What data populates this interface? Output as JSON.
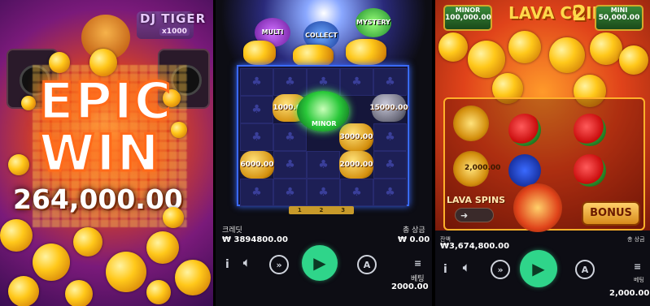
{
  "panel1": {
    "logo_title": "DJ TIGER",
    "logo_multiplier": "x1000",
    "headline_line1": "EPIC",
    "headline_line2": "WIN",
    "win_amount": "264,000.00"
  },
  "panel2": {
    "bonus_labels": [
      "MULTI",
      "COLLECT",
      "MYSTERY"
    ],
    "grid_values": [
      "1000.00",
      "15000.00",
      "3000.00",
      "6000.00",
      "2000.00"
    ],
    "center_symbol_label": "MINOR",
    "pages": [
      "1",
      "2",
      "3"
    ],
    "credit_label": "크레딧",
    "credit_value": "₩ 3894800.00",
    "total_win_label": "총 상금",
    "total_win_value": "₩ 0.00",
    "bet_label": "베팅",
    "bet_value": "2000.00",
    "info_label": "i",
    "accent_color": "#2fd58a"
  },
  "panel3": {
    "jackpot_minor_label": "MINOR",
    "jackpot_minor_value": "100,000.00",
    "jackpot_mini_label": "MINI",
    "jackpot_mini_value": "50,000.00",
    "game_title": "LAVA COINS",
    "game_title_number": "2",
    "reel_values": [
      "2,000.00"
    ],
    "lava_spins_label": "LAVA SPINS",
    "bonus_button": "BONUS",
    "balance_label": "잔액",
    "balance_value": "₩3,674,800.00",
    "total_win_label": "총 상금",
    "bet_label": "베팅",
    "bet_value": "2,000.00",
    "info_label": "i"
  }
}
